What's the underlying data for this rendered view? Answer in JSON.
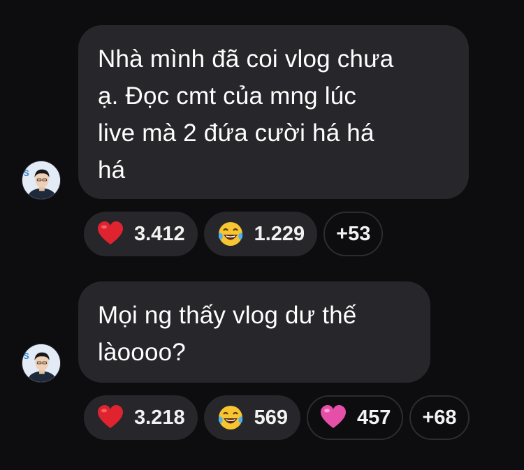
{
  "messages": [
    {
      "text": "Nhà mình đã coi vlog chưa\nạ. Đọc cmt của mng lúc\nlive mà 2 đứa cười há há\nhá",
      "reactions": [
        {
          "icon": "red-heart-icon",
          "count": "3.412"
        },
        {
          "icon": "laughing-tears-icon",
          "count": "1.229"
        }
      ],
      "more": "+53"
    },
    {
      "text": "Mọi ng thấy vlog dư thế\nlàoooo?",
      "reactions": [
        {
          "icon": "red-heart-icon",
          "count": "3.218"
        },
        {
          "icon": "laughing-tears-icon",
          "count": "569"
        },
        {
          "icon": "pink-heart-icon",
          "count": "457"
        }
      ],
      "more": "+68"
    }
  ],
  "colors": {
    "background": "#0d0d10",
    "bubble": "#26262b",
    "text": "#ffffff",
    "heart": "#e0242f",
    "pink_heart": "#e64fa8"
  }
}
